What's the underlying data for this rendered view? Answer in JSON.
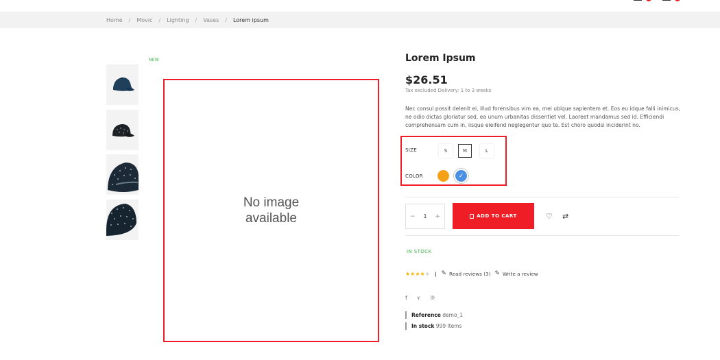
{
  "header": {
    "badge_count_1": "0",
    "badge_count_2": "0"
  },
  "breadcrumb": {
    "items": [
      "Home",
      "Movic",
      "Lighting",
      "Vases",
      "Lorem ipsum"
    ]
  },
  "gallery": {
    "new_label": "NEW",
    "placeholder_text": "No image\navailable"
  },
  "product": {
    "title": "Lorem Ipsum",
    "price": "$26.51",
    "tax_note": "Tax excluded Delivery: 1 to 3 weeks",
    "description": "Nec consul possit delenit ei, illud forensibus vim ea, mei ubique sapientem et. Eos eu idque falli inimicus, ne odio dictas gloriatur sed, ea unum urbanitas dissentiet vel. Laoreet mandamus sed id. Efficiendi comprehensam cum in, iisque eleifend neglegentur quo te. Est choro quodsi inciderint no.",
    "size_label": "SIZE",
    "sizes": [
      "S",
      "M",
      "L"
    ],
    "selected_size": "M",
    "color_label": "COLOR",
    "colors": [
      {
        "name": "orange",
        "hex": "#f5a117"
      },
      {
        "name": "blue",
        "hex": "#4a90e2",
        "selected": true
      }
    ],
    "quantity": "1",
    "qty_minus": "−",
    "qty_plus": "+",
    "add_to_cart": "ADD TO CART",
    "stock_status": "IN STOCK",
    "rating": 4,
    "rating_max": 5,
    "read_reviews": "Read reviews (3)",
    "write_review": "Write a review",
    "reference_label": "Reference",
    "reference_value": "demo_1",
    "in_stock_label": "In stock",
    "in_stock_value": "999 Items"
  },
  "colors": {
    "accent": "#ef1d26",
    "stock_green": "#3bb54a",
    "star": "#f5b400"
  }
}
